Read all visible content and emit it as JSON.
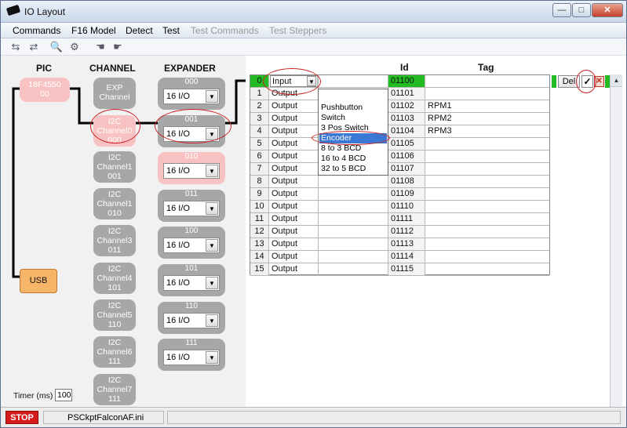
{
  "window": {
    "title": "IO Layout",
    "btn_min": "—",
    "btn_max": "□",
    "btn_close": "✕"
  },
  "menu": {
    "items": [
      {
        "label": "Commands",
        "disabled": false
      },
      {
        "label": "F16 Model",
        "disabled": false
      },
      {
        "label": "Detect",
        "disabled": false
      },
      {
        "label": "Test",
        "disabled": false
      },
      {
        "label": "Test Commands",
        "disabled": true
      },
      {
        "label": "Test Steppers",
        "disabled": true
      }
    ]
  },
  "toolbar": {
    "icons": [
      {
        "name": "network-icon",
        "glyph": "⇆"
      },
      {
        "name": "arrows-icon",
        "glyph": "⇄"
      },
      {
        "name": "magnifier-icon",
        "glyph": "🔍"
      },
      {
        "name": "gear-icon",
        "glyph": "⚙"
      },
      {
        "name": "hand-icon",
        "glyph": "☚"
      },
      {
        "name": "hand-pointer-icon",
        "glyph": "☛"
      }
    ]
  },
  "columns": {
    "pic": "PIC",
    "channel": "CHANNEL",
    "expander": "EXPANDER",
    "id": "Id",
    "tag": "Tag"
  },
  "pic": {
    "chip": "18F4550",
    "chip_sub": "00",
    "usb": "USB"
  },
  "channels": [
    {
      "line1": "EXP",
      "line2": "Channel",
      "line3": ""
    },
    {
      "line1": "I2C",
      "line2": "Channel0",
      "line3": "000"
    },
    {
      "line1": "I2C",
      "line2": "Channel1",
      "line3": "001"
    },
    {
      "line1": "I2C",
      "line2": "Channel1",
      "line3": "010"
    },
    {
      "line1": "I2C",
      "line2": "Channel3",
      "line3": "011"
    },
    {
      "line1": "I2C",
      "line2": "Channel4",
      "line3": "101"
    },
    {
      "line1": "I2C",
      "line2": "Channel5",
      "line3": "110"
    },
    {
      "line1": "I2C",
      "line2": "Channel6",
      "line3": "111"
    },
    {
      "line1": "I2C",
      "line2": "Channel7",
      "line3": "111"
    }
  ],
  "expanders": [
    {
      "code": "000",
      "value": "16 I/O"
    },
    {
      "code": "001",
      "value": "16 I/O"
    },
    {
      "code": "010",
      "value": "16 I/O"
    },
    {
      "code": "011",
      "value": "16 I/O"
    },
    {
      "code": "100",
      "value": "16 I/O"
    },
    {
      "code": "101",
      "value": "16 I/O"
    },
    {
      "code": "110",
      "value": "16 I/O"
    },
    {
      "code": "111",
      "value": "16 I/O"
    }
  ],
  "grid": {
    "rows": [
      {
        "n": "0",
        "dir": "Input",
        "ext": "",
        "id": "01100",
        "tag": ""
      },
      {
        "n": "1",
        "dir": "Output",
        "ext": "",
        "id": "01101",
        "tag": ""
      },
      {
        "n": "2",
        "dir": "Output",
        "ext": "",
        "id": "01102",
        "tag": "RPM1"
      },
      {
        "n": "3",
        "dir": "Output",
        "ext": "",
        "id": "01103",
        "tag": "RPM2"
      },
      {
        "n": "4",
        "dir": "Output",
        "ext": "",
        "id": "01104",
        "tag": "RPM3"
      },
      {
        "n": "5",
        "dir": "Output",
        "ext": "",
        "id": "01105",
        "tag": ""
      },
      {
        "n": "6",
        "dir": "Output",
        "ext": "",
        "id": "01106",
        "tag": ""
      },
      {
        "n": "7",
        "dir": "Output",
        "ext": "",
        "id": "01107",
        "tag": ""
      },
      {
        "n": "8",
        "dir": "Output",
        "ext": "",
        "id": "01108",
        "tag": ""
      },
      {
        "n": "9",
        "dir": "Output",
        "ext": "",
        "id": "01109",
        "tag": ""
      },
      {
        "n": "10",
        "dir": "Output",
        "ext": "",
        "id": "01110",
        "tag": ""
      },
      {
        "n": "11",
        "dir": "Output",
        "ext": "",
        "id": "01111",
        "tag": ""
      },
      {
        "n": "12",
        "dir": "Output",
        "ext": "",
        "id": "01112",
        "tag": ""
      },
      {
        "n": "13",
        "dir": "Output",
        "ext": "",
        "id": "01113",
        "tag": ""
      },
      {
        "n": "14",
        "dir": "Output",
        "ext": "",
        "id": "01114",
        "tag": ""
      },
      {
        "n": "15",
        "dir": "Output",
        "ext": "",
        "id": "01115",
        "tag": ""
      }
    ]
  },
  "dropdown": {
    "options": [
      "",
      "Pushbutton",
      "Switch",
      "3 Pos Switch",
      "Encoder",
      " 8 to 3 BCD",
      "16 to 4 BCD",
      "32 to 5 BCD"
    ],
    "highlighted": "Encoder"
  },
  "row_actions": {
    "del": "Del",
    "check": "✓",
    "cancel": "✕"
  },
  "timer": {
    "label": "Timer (ms)",
    "value": "100"
  },
  "status": {
    "stop": "STOP",
    "file": "PSCkptFalconAF.ini"
  },
  "colors": {
    "active_green": "#22bb22",
    "pink_selected": "#f9c2c2",
    "usb_orange": "#f7b56a",
    "highlight_blue": "#3b78d4",
    "stop_red": "#d71b1b",
    "annotation_red": "#cc2222"
  }
}
